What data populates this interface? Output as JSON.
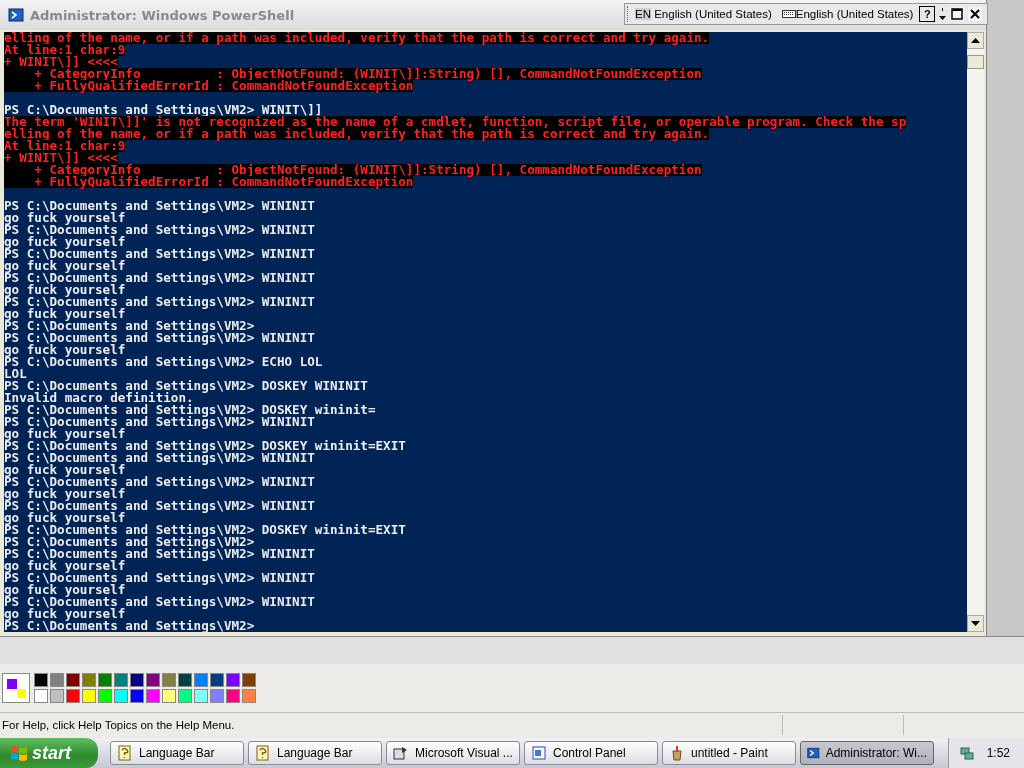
{
  "window": {
    "title": "Administrator: Windows PowerShell"
  },
  "language_bar": {
    "language_code": "EN",
    "language": "English (United States)",
    "keyboard": "English (United States)",
    "help": "?"
  },
  "console": {
    "lines": [
      {
        "kind": "error",
        "text": "elling of the name, or if a path was included, verify that the path is correct and try again."
      },
      {
        "kind": "error",
        "text": "At line:1 char:9"
      },
      {
        "kind": "error",
        "text": "+ WINIT\\]] <<<<"
      },
      {
        "kind": "error",
        "text": "    + CategoryInfo          : ObjectNotFound: (WINIT\\]]:String) [], CommandNotFoundException"
      },
      {
        "kind": "error",
        "text": "    + FullyQualifiedErrorId : CommandNotFoundException"
      },
      {
        "kind": "blank"
      },
      {
        "kind": "output",
        "text": "PS C:\\Documents and Settings\\VM2> WINIT\\]]"
      },
      {
        "kind": "error",
        "text": "The term 'WINIT\\]]' is not recognized as the name of a cmdlet, function, script file, or operable program. Check the sp"
      },
      {
        "kind": "error",
        "text": "elling of the name, or if a path was included, verify that the path is correct and try again."
      },
      {
        "kind": "error",
        "text": "At line:1 char:9"
      },
      {
        "kind": "error",
        "text": "+ WINIT\\]] <<<<"
      },
      {
        "kind": "error",
        "text": "    + CategoryInfo          : ObjectNotFound: (WINIT\\]]:String) [], CommandNotFoundException"
      },
      {
        "kind": "error",
        "text": "    + FullyQualifiedErrorId : CommandNotFoundException"
      },
      {
        "kind": "blank"
      },
      {
        "kind": "output",
        "text": "PS C:\\Documents and Settings\\VM2> WININIT"
      },
      {
        "kind": "output",
        "text": "go fuck yourself"
      },
      {
        "kind": "output",
        "text": "PS C:\\Documents and Settings\\VM2> WININIT"
      },
      {
        "kind": "output",
        "text": "go fuck yourself"
      },
      {
        "kind": "output",
        "text": "PS C:\\Documents and Settings\\VM2> WININIT"
      },
      {
        "kind": "output",
        "text": "go fuck yourself"
      },
      {
        "kind": "output",
        "text": "PS C:\\Documents and Settings\\VM2> WININIT"
      },
      {
        "kind": "output",
        "text": "go fuck yourself"
      },
      {
        "kind": "output",
        "text": "PS C:\\Documents and Settings\\VM2> WININIT"
      },
      {
        "kind": "output",
        "text": "go fuck yourself"
      },
      {
        "kind": "output",
        "text": "PS C:\\Documents and Settings\\VM2>"
      },
      {
        "kind": "output",
        "text": "PS C:\\Documents and Settings\\VM2> WININIT"
      },
      {
        "kind": "output",
        "text": "go fuck yourself"
      },
      {
        "kind": "output",
        "text": "PS C:\\Documents and Settings\\VM2> ECHO LOL"
      },
      {
        "kind": "output",
        "text": "LOL"
      },
      {
        "kind": "output",
        "text": "PS C:\\Documents and Settings\\VM2> DOSKEY WININIT"
      },
      {
        "kind": "output",
        "text": "Invalid macro definition."
      },
      {
        "kind": "output",
        "text": "PS C:\\Documents and Settings\\VM2> DOSKEY wininit="
      },
      {
        "kind": "output",
        "text": "PS C:\\Documents and Settings\\VM2> WININIT"
      },
      {
        "kind": "output",
        "text": "go fuck yourself"
      },
      {
        "kind": "output",
        "text": "PS C:\\Documents and Settings\\VM2> DOSKEY wininit=EXIT"
      },
      {
        "kind": "output",
        "text": "PS C:\\Documents and Settings\\VM2> WININIT"
      },
      {
        "kind": "output",
        "text": "go fuck yourself"
      },
      {
        "kind": "output",
        "text": "PS C:\\Documents and Settings\\VM2> WININIT"
      },
      {
        "kind": "output",
        "text": "go fuck yourself"
      },
      {
        "kind": "output",
        "text": "PS C:\\Documents and Settings\\VM2> WININIT"
      },
      {
        "kind": "output",
        "text": "go fuck yourself"
      },
      {
        "kind": "output",
        "text": "PS C:\\Documents and Settings\\VM2> DOSKEY wininit=EXIT"
      },
      {
        "kind": "output",
        "text": "PS C:\\Documents and Settings\\VM2>"
      },
      {
        "kind": "output",
        "text": "PS C:\\Documents and Settings\\VM2> WININIT"
      },
      {
        "kind": "output",
        "text": "go fuck yourself"
      },
      {
        "kind": "output",
        "text": "PS C:\\Documents and Settings\\VM2> WININIT"
      },
      {
        "kind": "output",
        "text": "go fuck yourself"
      },
      {
        "kind": "output",
        "text": "PS C:\\Documents and Settings\\VM2> WININIT"
      },
      {
        "kind": "output",
        "text": "go fuck yourself"
      },
      {
        "kind": "output",
        "text": "PS C:\\Documents and Settings\\VM2>"
      }
    ]
  },
  "paint": {
    "current_colors": {
      "foreground": {
        "color": "#8000ff"
      },
      "background": {
        "color": "#ffff00"
      }
    },
    "palette": [
      {
        "color": "#000000"
      },
      {
        "color": "#808080"
      },
      {
        "color": "#800000"
      },
      {
        "color": "#808000"
      },
      {
        "color": "#008000"
      },
      {
        "color": "#008080"
      },
      {
        "color": "#000080"
      },
      {
        "color": "#800080"
      },
      {
        "color": "#808040"
      },
      {
        "color": "#004040"
      },
      {
        "color": "#0080ff"
      },
      {
        "color": "#004080"
      },
      {
        "color": "#8000ff"
      },
      {
        "color": "#804000"
      },
      {
        "color": "#ffffff"
      },
      {
        "color": "#c0c0c0"
      },
      {
        "color": "#ff0000"
      },
      {
        "color": "#ffff00"
      },
      {
        "color": "#00ff00"
      },
      {
        "color": "#00ffff"
      },
      {
        "color": "#0000ff"
      },
      {
        "color": "#ff00ff"
      },
      {
        "color": "#ffff80"
      },
      {
        "color": "#00ff80"
      },
      {
        "color": "#80ffff"
      },
      {
        "color": "#8080ff"
      },
      {
        "color": "#ff0080"
      },
      {
        "color": "#ff8040"
      }
    ],
    "status": "For Help, click Help Topics on the Help Menu."
  },
  "taskbar": {
    "start": "start",
    "items": [
      {
        "kind": "help",
        "label": "Language Bar",
        "selected": false
      },
      {
        "kind": "help",
        "label": "Language Bar",
        "selected": false
      },
      {
        "kind": "app",
        "label": "Microsoft Visual ...",
        "selected": false
      },
      {
        "kind": "panel",
        "label": "Control Panel",
        "selected": false
      },
      {
        "kind": "paint",
        "label": "untitled - Paint",
        "selected": false
      },
      {
        "kind": "shell",
        "label": "Administrator: Wi...",
        "selected": true
      }
    ],
    "clock": "1:52"
  }
}
